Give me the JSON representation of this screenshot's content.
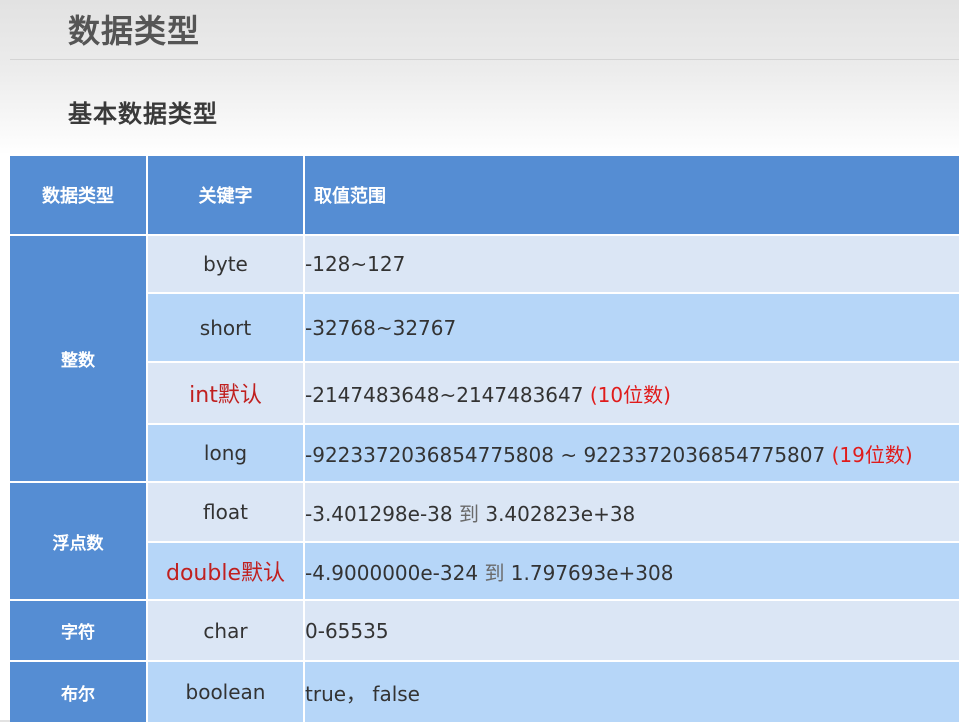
{
  "header": {
    "title": "数据类型",
    "subtitle": "基本数据类型"
  },
  "table": {
    "columns": [
      "数据类型",
      "关键字",
      "取值范围"
    ],
    "groups": {
      "integer": "整数",
      "float": "浮点数",
      "char": "字符",
      "bool": "布尔"
    },
    "rows": [
      {
        "keyword": "byte",
        "range": "-128~127"
      },
      {
        "keyword": "short",
        "range": "-32768~32767"
      },
      {
        "keyword": "int默认",
        "range": "-2147483648~2147483647",
        "note": "(10位数)"
      },
      {
        "keyword": "long",
        "range": "-9223372036854775808 ~ 9223372036854775807",
        "note": "(19位数)"
      },
      {
        "keyword": "float",
        "range_min": "-3.401298e-38",
        "range_to": "到",
        "range_max": "3.402823e+38"
      },
      {
        "keyword": "double默认",
        "range_min": "-4.9000000e-324",
        "range_to": "到",
        "range_max": "1.797693e+308"
      },
      {
        "keyword": "char",
        "range": "0-65535"
      },
      {
        "keyword": "boolean",
        "range": "true， false"
      }
    ]
  },
  "colors": {
    "header_blue": "#558dd3",
    "row_light": "#dbe6f5",
    "row_mid": "#b6d6f8",
    "highlight_red": "#c0201f"
  }
}
